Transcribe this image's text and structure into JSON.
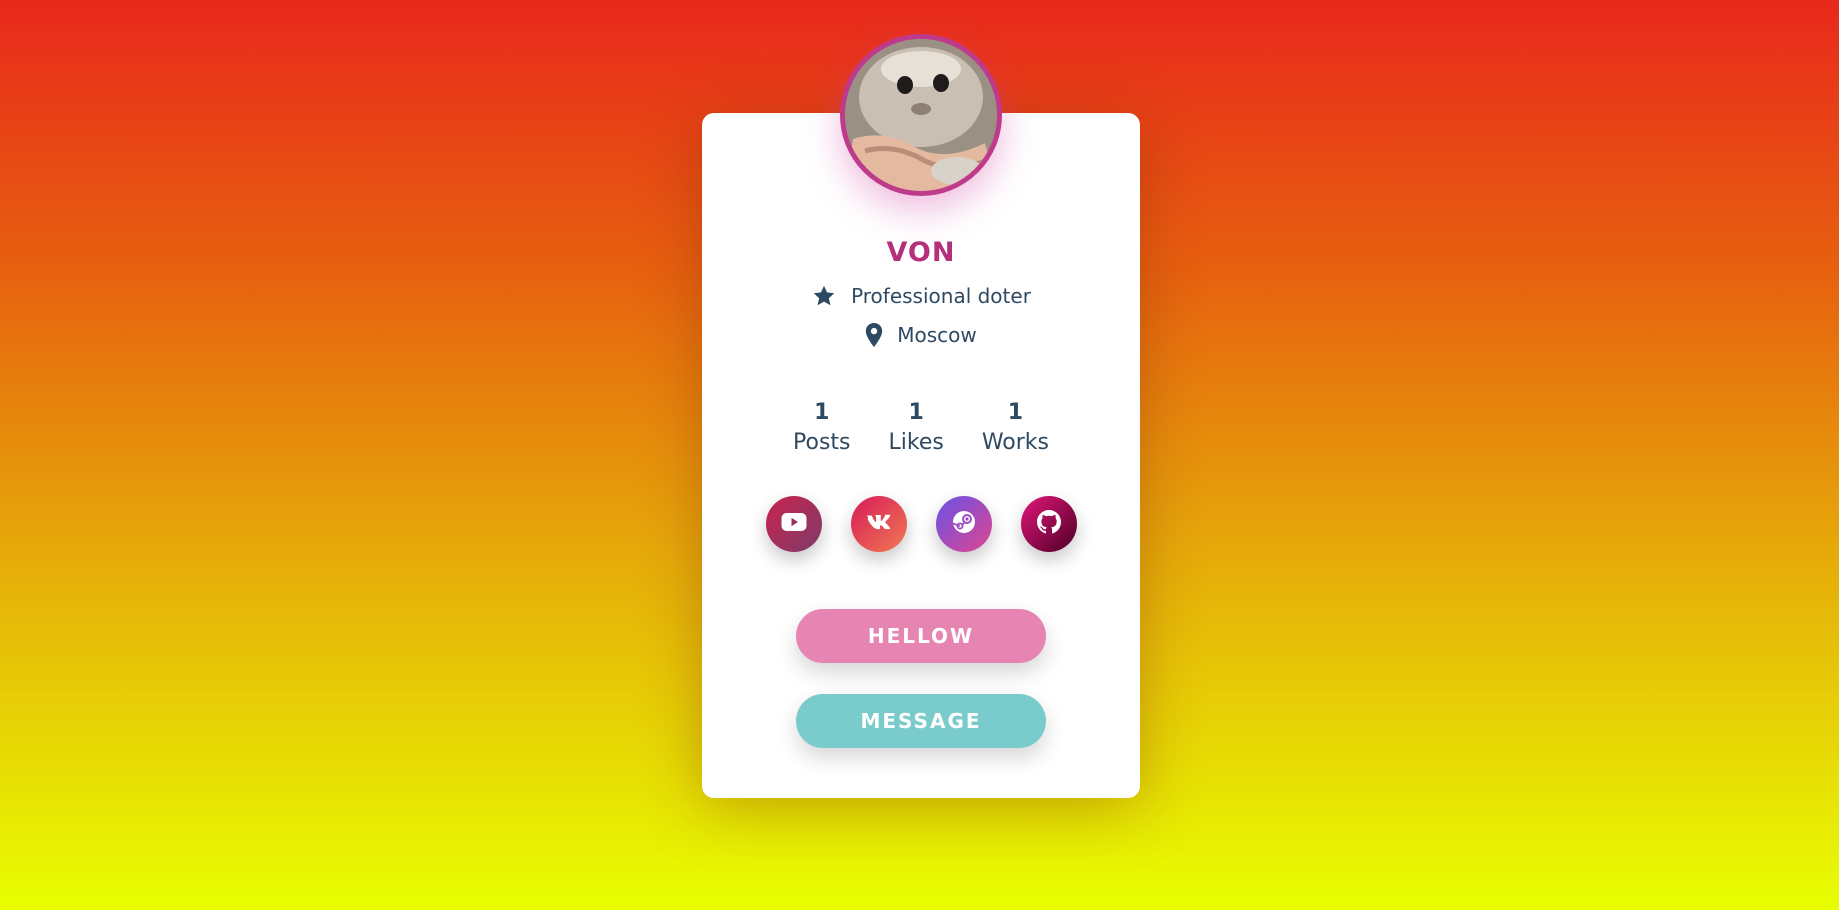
{
  "profile": {
    "name": "VON",
    "title": "Professional doter",
    "location": "Moscow",
    "avatar_alt": "hamster avatar"
  },
  "stats": [
    {
      "value": "1",
      "label": "Posts"
    },
    {
      "value": "1",
      "label": "Likes"
    },
    {
      "value": "1",
      "label": "Works"
    }
  ],
  "socials": [
    {
      "name": "youtube",
      "icon": "youtube-icon"
    },
    {
      "name": "vk",
      "icon": "vk-icon"
    },
    {
      "name": "steam",
      "icon": "steam-icon"
    },
    {
      "name": "github",
      "icon": "github-icon"
    }
  ],
  "buttons": {
    "primary_label": "HELLOW",
    "secondary_label": "MESSAGE"
  },
  "colors": {
    "name": "#b5307a",
    "text": "#2e4a62",
    "primary_button": "#e685b2",
    "secondary_button": "#79cccb",
    "avatar_border": "#c03a8c"
  }
}
